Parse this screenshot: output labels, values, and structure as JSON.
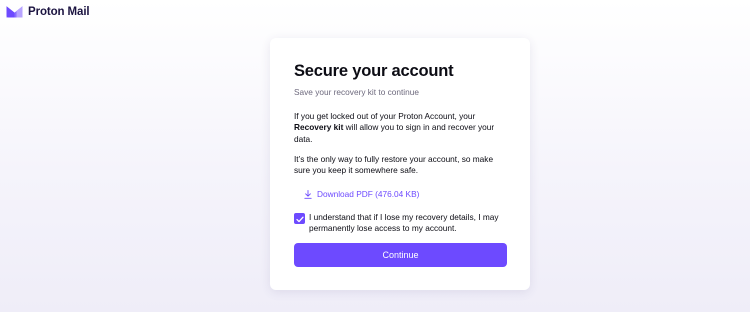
{
  "header": {
    "logo_text": "Proton Mail",
    "logo_icon": "proton-mail-envelope-icon"
  },
  "card": {
    "title": "Secure your account",
    "subtitle": "Save your recovery kit to continue",
    "para1_before": "If you get locked out of your Proton Account, your ",
    "para1_bold": "Recovery kit",
    "para1_after": " will allow you to sign in and recover your data.",
    "para2": "It’s the only way to fully restore your account, so make sure you keep it somewhere safe.",
    "download_icon": "download-icon",
    "download_label": "Download PDF (476.04 KB)",
    "checkbox_checked": true,
    "checkbox_label": "I understand that if I lose my recovery details, I may permanently lose access to my account.",
    "continue_label": "Continue"
  },
  "colors": {
    "accent": "#6d4aff",
    "text": "#0c0c14",
    "muted": "#6d697d"
  }
}
